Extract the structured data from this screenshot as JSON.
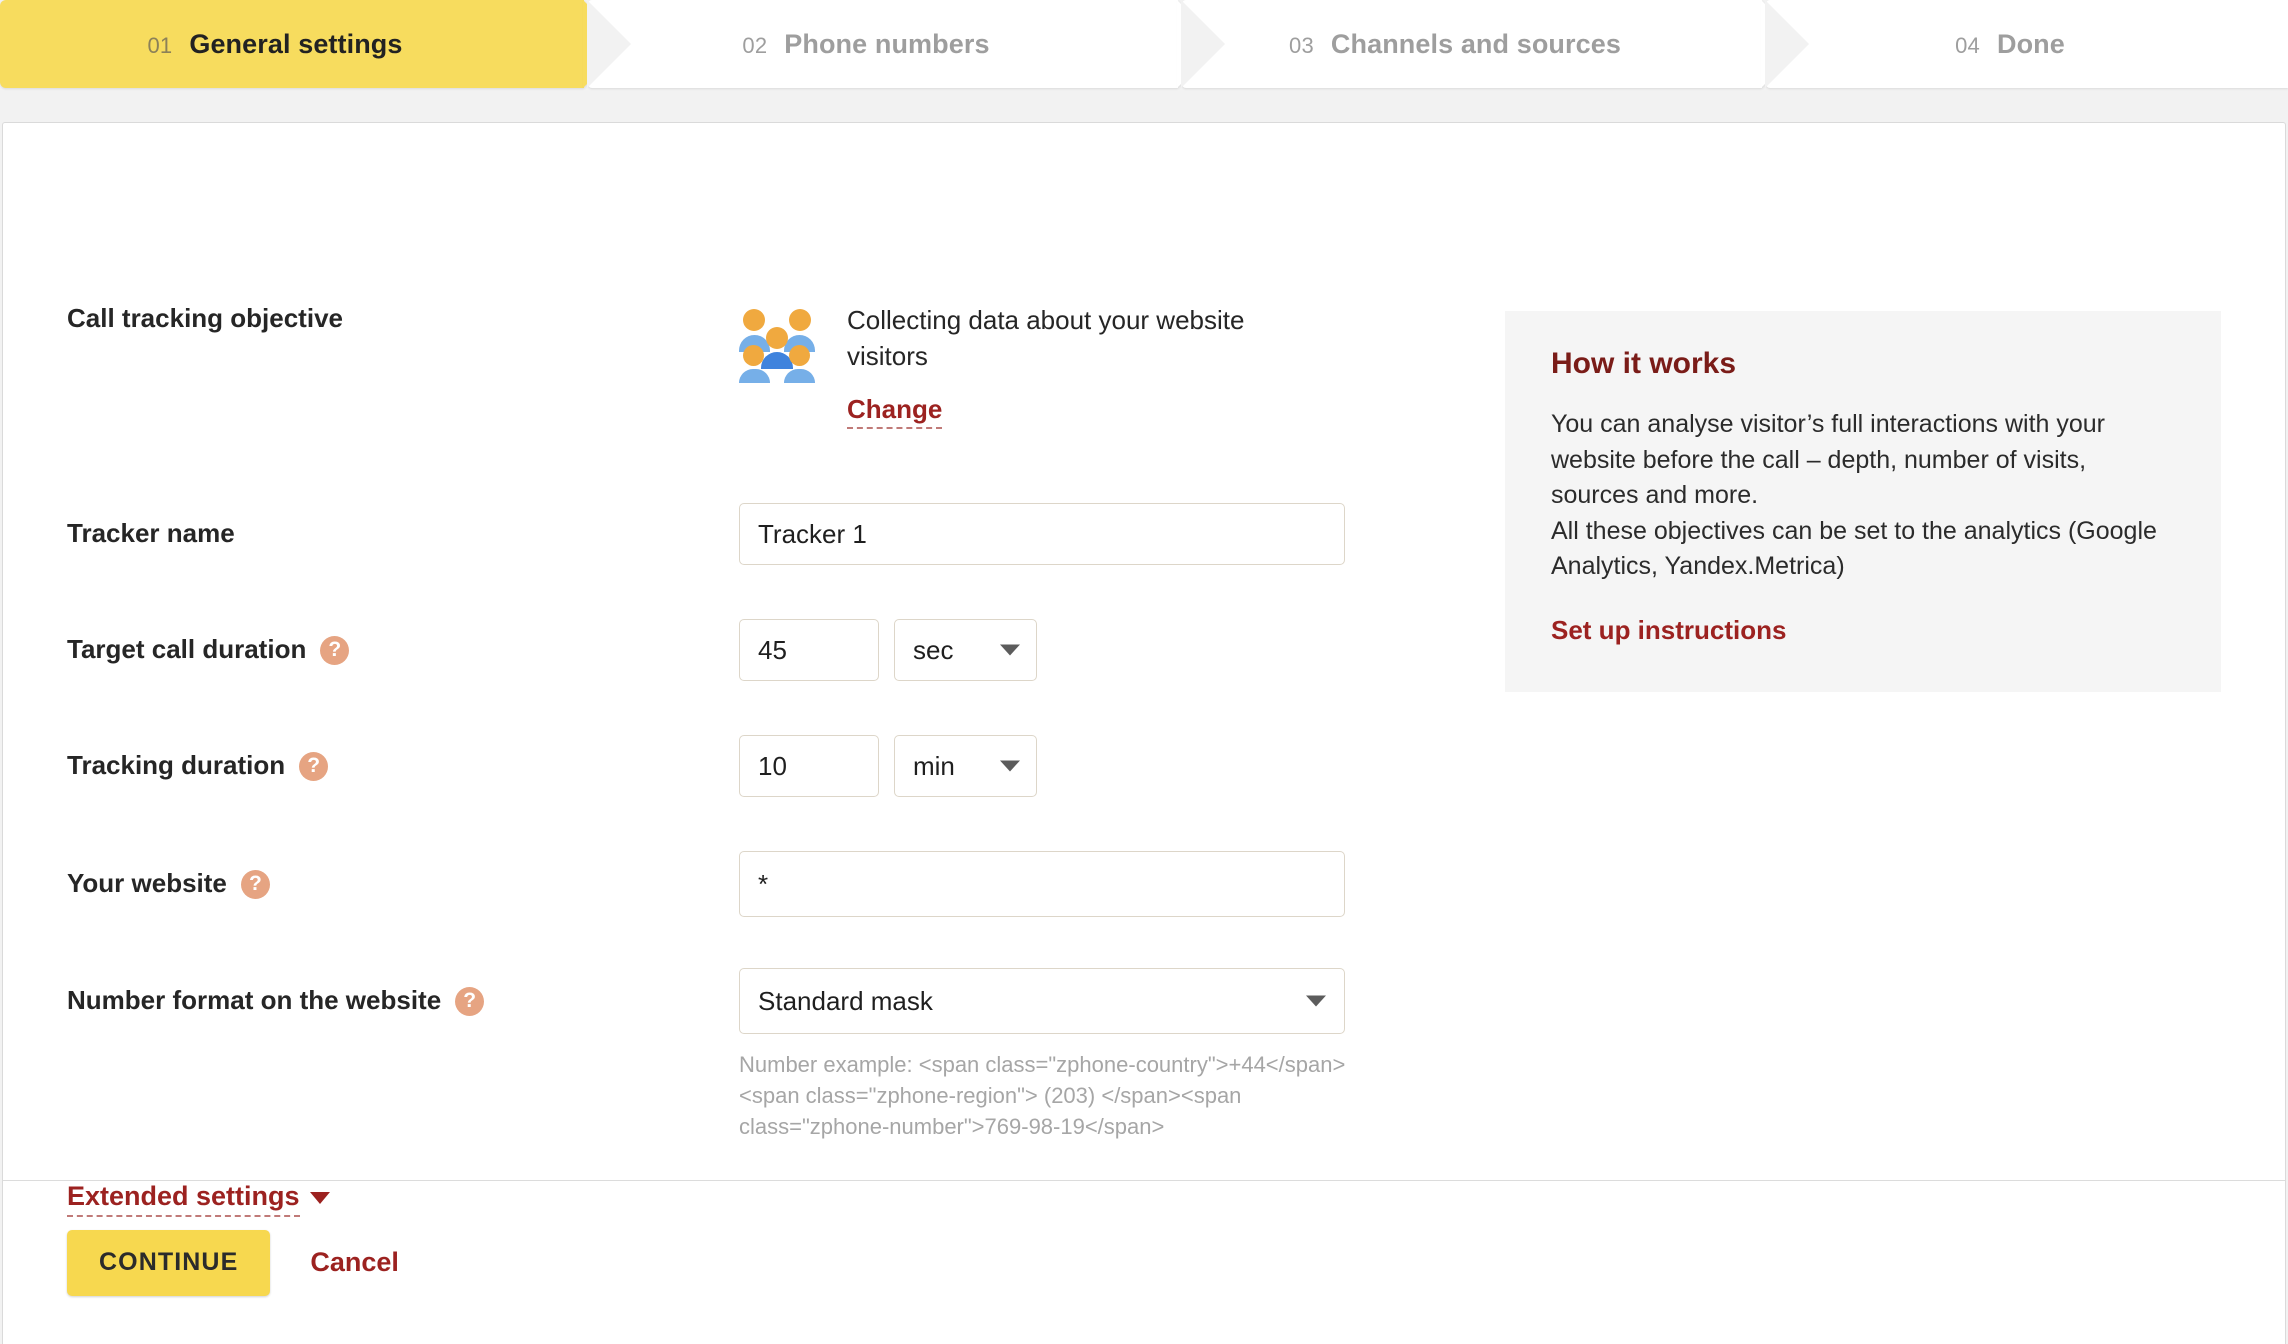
{
  "steps": [
    {
      "num": "01",
      "label": "General settings",
      "active": true
    },
    {
      "num": "02",
      "label": "Phone numbers",
      "active": false
    },
    {
      "num": "03",
      "label": "Channels and sources",
      "active": false
    },
    {
      "num": "04",
      "label": "Done",
      "active": false
    }
  ],
  "form": {
    "objective": {
      "label": "Call tracking objective",
      "value": "Collecting data about your website visitors",
      "change_label": "Change",
      "icon": "people-group-icon"
    },
    "tracker_name": {
      "label": "Tracker name",
      "value": "Tracker 1"
    },
    "target_call_duration": {
      "label": "Target call duration",
      "value": "45",
      "unit": "sec",
      "help": "help-icon"
    },
    "tracking_duration": {
      "label": "Tracking duration",
      "value": "10",
      "unit": "min",
      "help": "help-icon"
    },
    "your_website": {
      "label": "Your website",
      "value": "*",
      "help": "help-icon"
    },
    "number_format": {
      "label": "Number format on the website",
      "value": "Standard mask",
      "help": "help-icon",
      "hint": "Number example: <span class=\"zphone-country\">+44</span><span class=\"zphone-region\"> (203) </span><span class=\"zphone-number\">769-98-19</span>"
    },
    "extended_settings_label": "Extended settings"
  },
  "side_panel": {
    "title": "How it works",
    "body": "You can analyse visitor’s full interactions with your website before the call – depth, number of visits, sources and more.\nAll these objectives can be set to the analytics (Google Analytics, Yandex.Metrica)",
    "link": "Set up instructions"
  },
  "footer": {
    "continue_label": "CONTINUE",
    "cancel_label": "Cancel"
  },
  "colors": {
    "accent_yellow": "#f7dc5e",
    "link_red": "#9c2220",
    "help_orange": "#e6a482",
    "panel_bg": "#f5f5f5",
    "icon_orange": "#f0a93f",
    "icon_blue_light": "#76afe8",
    "icon_blue_dark": "#3f83dd"
  }
}
